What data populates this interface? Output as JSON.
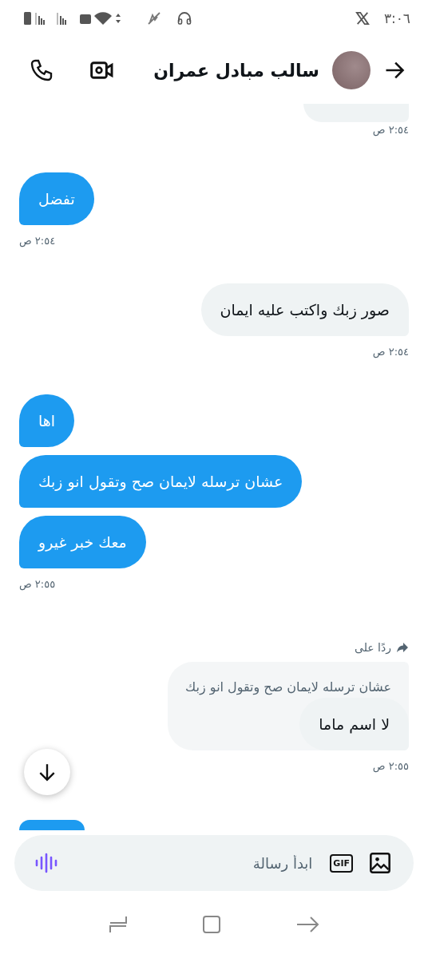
{
  "status_bar": {
    "time": "٣:٠٦"
  },
  "header": {
    "contact_name": "سالب مبادل عمران"
  },
  "messages": [
    {
      "kind": "cut",
      "outgoing": true
    },
    {
      "kind": "time",
      "outgoing": true,
      "text": "٢:٥٤ ص"
    },
    {
      "kind": "bubble",
      "outgoing": false,
      "text": "تفضل"
    },
    {
      "kind": "time",
      "outgoing": false,
      "text": "٢:٥٤ ص"
    },
    {
      "kind": "bubble",
      "outgoing": true,
      "text": "صور زبك واكتب عليه ايمان"
    },
    {
      "kind": "time",
      "outgoing": true,
      "text": "٢:٥٤ ص"
    },
    {
      "kind": "bubble",
      "outgoing": false,
      "text": "اها"
    },
    {
      "kind": "bubble",
      "outgoing": false,
      "text": "عشان ترسله لايمان صح وتقول انو زبك"
    },
    {
      "kind": "bubble",
      "outgoing": false,
      "text": "معك خبر غيرو"
    },
    {
      "kind": "time",
      "outgoing": false,
      "text": "٢:٥٥ ص"
    },
    {
      "kind": "reply",
      "outgoing": true,
      "label": "ردًا على",
      "quote": "عشان ترسله لايمان صح وتقول انو زبك",
      "text": "لا اسم ماما"
    },
    {
      "kind": "time",
      "outgoing": true,
      "text": "٢:٥٥ ص"
    },
    {
      "kind": "cut",
      "outgoing": false
    }
  ],
  "composer": {
    "placeholder": "ابدأ رسالة",
    "gif_label": "GIF"
  }
}
